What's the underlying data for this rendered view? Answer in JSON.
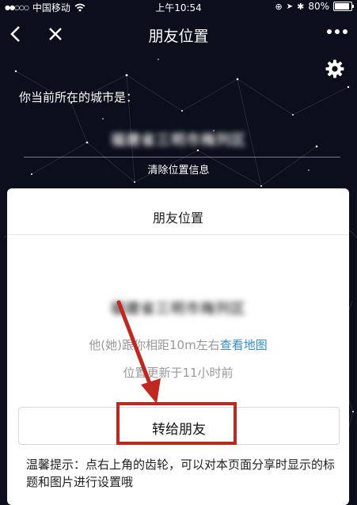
{
  "status_bar": {
    "signal_bars": "●●○○○",
    "carrier": "中国移动",
    "wifi_icon": "wifi-icon",
    "time": "上午10:54",
    "battery": "80%",
    "battery_level": 0.8
  },
  "nav": {
    "title": "朋友位置",
    "back_icon": "chevron-left-icon",
    "close_icon": "close-icon",
    "more_icon": "more-icon"
  },
  "header": {
    "city_label": "你当前所在的城市是：",
    "city_name": "福建省三明市梅列区",
    "clear_label": "清除位置信息",
    "settings_icon": "gear-icon"
  },
  "card": {
    "title": "朋友位置",
    "city_name": "福建省三明市梅列区",
    "distance_prefix": "他(她)跟你相距10m左右",
    "map_link": "查看地图",
    "updated": "位置更新于11小时前",
    "forward_button": "转给朋友"
  },
  "tip": "温馨提示：点右上角的齿轮，可以对本页面分享时显示的标题和图片进行设置哦",
  "colors": {
    "background": "#0b0f1c",
    "link": "#2f8fd0",
    "annotation_red": "#c0271f"
  }
}
